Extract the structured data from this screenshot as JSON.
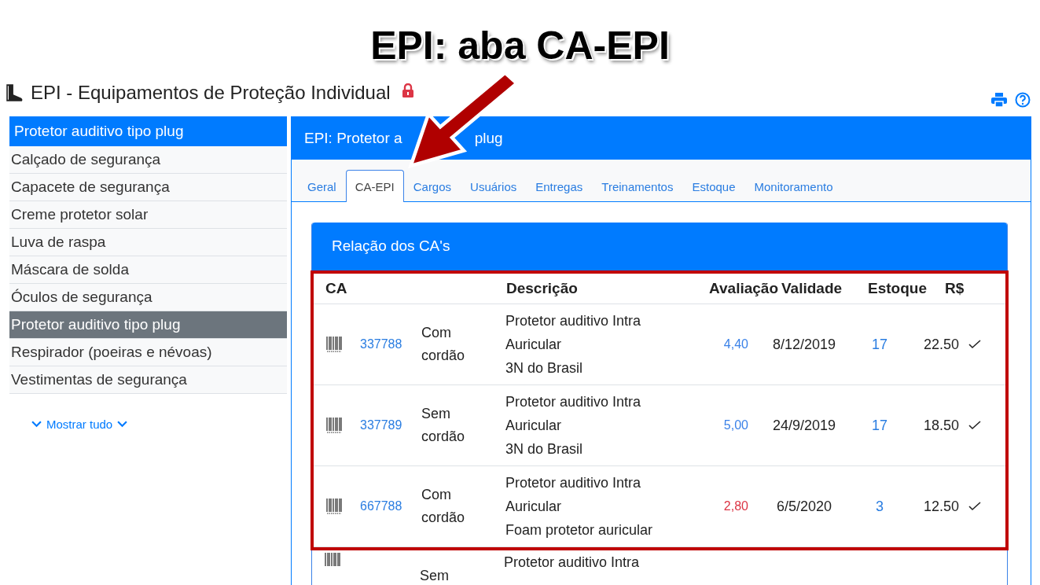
{
  "annotation": {
    "title": "EPI: aba CA-EPI"
  },
  "header": {
    "title": "EPI - Equipamentos de Proteção Individual",
    "locked": true
  },
  "sidebar": {
    "heading": "Protetor auditivo tipo plug",
    "items": [
      {
        "label": "Calçado de segurança",
        "selected": false
      },
      {
        "label": "Capacete de segurança",
        "selected": false
      },
      {
        "label": "Creme protetor solar",
        "selected": false
      },
      {
        "label": "Luva de raspa",
        "selected": false
      },
      {
        "label": "Máscara de solda",
        "selected": false
      },
      {
        "label": "Óculos de segurança",
        "selected": false
      },
      {
        "label": "Protetor auditivo tipo plug",
        "selected": true
      },
      {
        "label": "Respirador (poeiras e névoas)",
        "selected": false
      },
      {
        "label": "Vestimentas de segurança",
        "selected": false
      }
    ],
    "show_all": "Mostrar tudo"
  },
  "panel": {
    "title": [
      "EPI: Protetor a",
      "plug"
    ],
    "tabs": [
      {
        "label": "Geral",
        "selected": false
      },
      {
        "label": "CA-EPI",
        "selected": true
      },
      {
        "label": "Cargos",
        "selected": false
      },
      {
        "label": "Usuários",
        "selected": false
      },
      {
        "label": "Entregas",
        "selected": false
      },
      {
        "label": "Treinamentos",
        "selected": false
      },
      {
        "label": "Estoque",
        "selected": false
      },
      {
        "label": "Monitoramento",
        "selected": false
      }
    ],
    "card_title": "Relação dos CA's",
    "columns": [
      "CA",
      "Descrição",
      "Avaliação",
      "Validade",
      "Estoque",
      "R$"
    ],
    "rows": [
      {
        "highlighted": true,
        "ca": "337788",
        "type": "Com cordão",
        "description": "Protetor auditivo Intra Auricular",
        "maker": "3N do Brasil",
        "rating": "4,40",
        "color": "#3b82e8",
        "validity": "8/12/2019",
        "stock": "17",
        "price": "22.50",
        "active": true
      },
      {
        "highlighted": true,
        "ca": "337789",
        "type": "Sem cordão",
        "description": "Protetor auditivo Intra Auricular",
        "maker": "3N do Brasil",
        "rating": "5,00",
        "color": "#3b82e8",
        "validity": "24/9/2019",
        "stock": "17",
        "price": "18.50",
        "active": true
      },
      {
        "highlighted": true,
        "ca": "667788",
        "type": "Com cordão",
        "description": "Protetor auditivo Intra Auricular",
        "maker": "Foam protetor auricular",
        "rating": "2,80",
        "color": "#dc3545",
        "validity": "6/5/2020",
        "stock": "3",
        "price": "12.50",
        "active": true
      },
      {
        "highlighted": false,
        "type": "Sem",
        "description": "Protetor auditivo Intra"
      }
    ]
  }
}
